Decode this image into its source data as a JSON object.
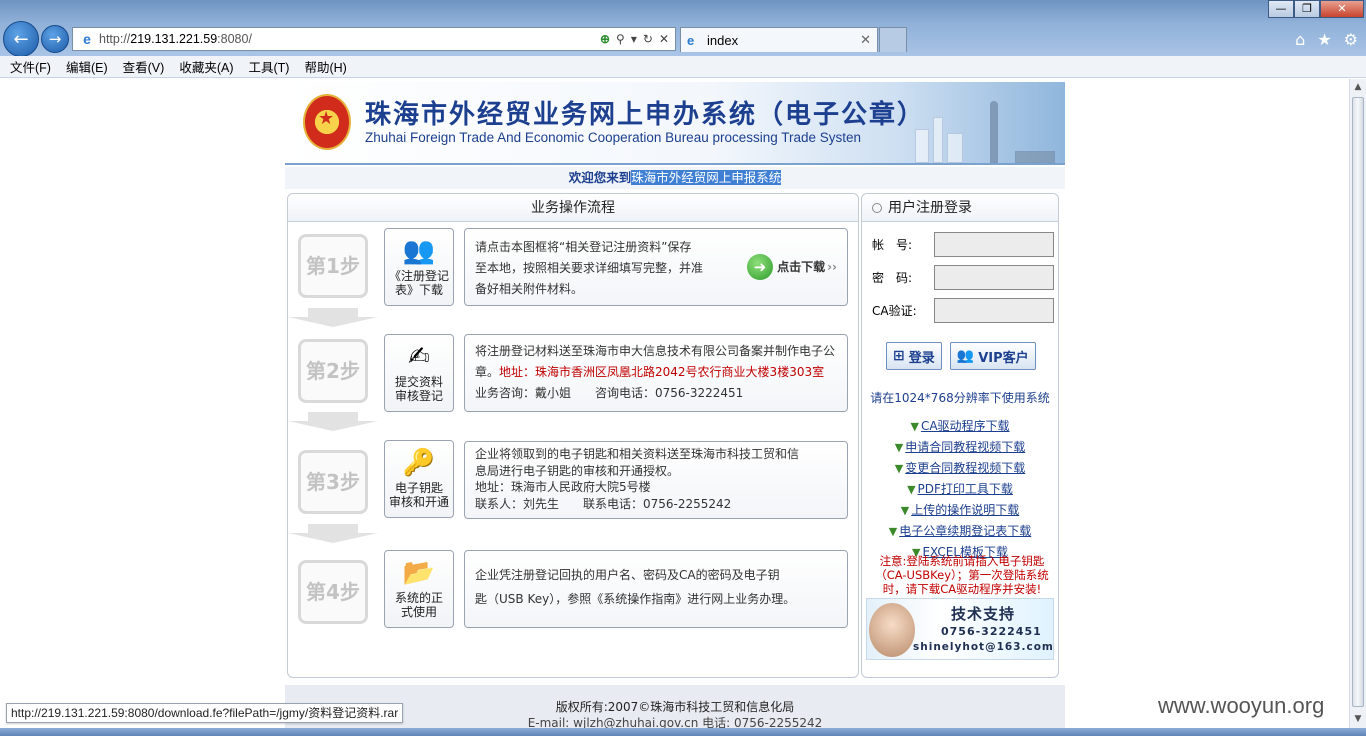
{
  "browser": {
    "url_prefix": "http://",
    "url_host": "219.131.221.59",
    "url_rest": ":8080/",
    "tab_title": "index",
    "menu": [
      "文件(F)",
      "编辑(E)",
      "查看(V)",
      "收藏夹(A)",
      "工具(T)",
      "帮助(H)"
    ]
  },
  "banner": {
    "title": "珠海市外经贸业务网上申办系统（电子公章）",
    "subtitle": "Zhuhai Foreign Trade And Economic Cooperation Bureau processing Trade Systen"
  },
  "welcome": {
    "prefix": "欢迎您来到",
    "highlight": "珠海市外经贸网上申报系统"
  },
  "process": {
    "title": "业务操作流程",
    "steps": [
      {
        "badge": "第1步",
        "icon_label_1": "《注册登记",
        "icon_label_2": "表》下载",
        "line1": "请点击本图框将“相关登记注册资料”保存",
        "line2": "至本地，按照相关要求详细填写完整，并准",
        "line3": "备好相关附件材料。",
        "download_label": "点击下载",
        "download_chevron": "››"
      },
      {
        "badge": "第2步",
        "icon_label_1": "提交资料",
        "icon_label_2": "审核登记",
        "line1": "将注册登记材料送至珠海市申大信息技术有限公司备案并制作电子公",
        "line2_a": "章。",
        "line2_red": "地址：珠海市香洲区凤凰北路2042号农行商业大楼3楼303室",
        "line3": "业务咨询：戴小姐　　咨询电话：0756-3222451"
      },
      {
        "badge": "第3步",
        "icon_label_1": "电子钥匙",
        "icon_label_2": "审核和开通",
        "line1": "企业将领取到的电子钥匙和相关资料送至珠海市科技工贸和信",
        "line2": "息局进行电子钥匙的审核和开通授权。",
        "line3": "地址：珠海市人民政府大院5号楼",
        "line4": "联系人：刘先生　　联系电话：0756-2255242"
      },
      {
        "badge": "第4步",
        "icon_label_1": "系统的正",
        "icon_label_2": "式使用",
        "line1": "企业凭注册登记回执的用户名、密码及CA的密码及电子钥",
        "line2": "匙（USB Key），参照《系统操作指南》进行网上业务办理。"
      }
    ]
  },
  "login": {
    "title": "用户注册登录",
    "account_label": "帐　号:",
    "password_label": "密　码:",
    "ca_label": "CA验证:",
    "login_button": "登录",
    "vip_button": "VIP客户",
    "resolution_notice": "请在1024*768分辨率下使用系统",
    "links": [
      "CA驱动程序下载",
      "申请合同教程视频下载",
      "变更合同教程视频下载",
      "PDF打印工具下载",
      "上传的操作说明下载",
      "电子公章续期登记表下载",
      "EXCEL模板下载"
    ],
    "warning_1": "注意:登陆系统前请插入电子钥匙",
    "warning_2": "（CA-USBKey）；第一次登陆系统",
    "warning_3": "时，请下载CA驱动程序并安装!",
    "support_title": "技术支持",
    "support_phone": "0756-3222451",
    "support_email": "shinelyhot@163.com"
  },
  "footer": {
    "line1": "版权所有:2007©珠海市科技工贸和信息化局",
    "line2": "E-mail: wjlzh@zhuhai.gov.cn 电话: 0756-2255242"
  },
  "status_tip": "http://219.131.221.59:8080/download.fe?filePath=/jgmy/资料登记资料.rar",
  "watermark": "www.wooyun.org"
}
